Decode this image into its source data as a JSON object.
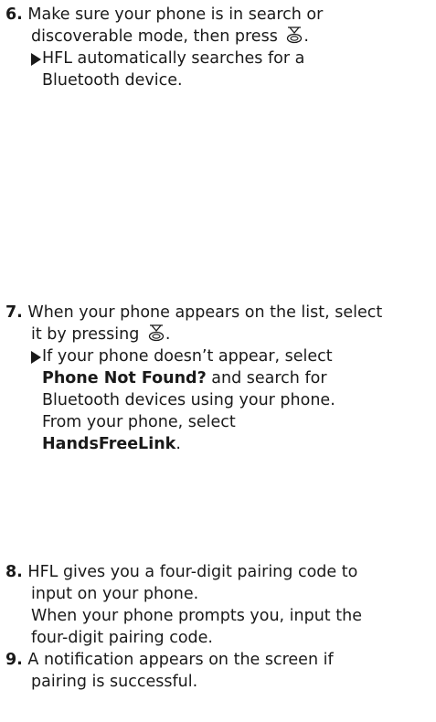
{
  "steps": [
    {
      "number": "6.",
      "line1": "Make sure your phone is in search or",
      "line2_pre": "discoverable mode, then press ",
      "line2_post": ".",
      "sub": {
        "line1": "HFL automatically searches for a",
        "line2": "Bluetooth device."
      }
    },
    {
      "number": "7.",
      "line1": "When your phone appears on the list, select",
      "line2_pre": "it by pressing ",
      "line2_post": ".",
      "sub": {
        "line1": "If your phone doesn’t appear, select",
        "line2_bold": "Phone Not Found?",
        "line2_rest": " and search for",
        "line3": "Bluetooth devices using your phone.",
        "line4": "From your phone, select",
        "line5_bold": "HandsFreeLink",
        "line5_rest": "."
      }
    },
    {
      "number": "8.",
      "line1": "HFL gives you a four-digit pairing code to",
      "line2": "input on your phone.",
      "line3": "When your phone prompts you, input the",
      "line4": "four-digit pairing code."
    },
    {
      "number": "9.",
      "line1": "A notification appears on the screen if",
      "line2": "pairing is successful."
    }
  ],
  "icons": {
    "selector_knob": "interface-dial-press-icon",
    "bullet": "right-triangle-arrow-icon"
  }
}
